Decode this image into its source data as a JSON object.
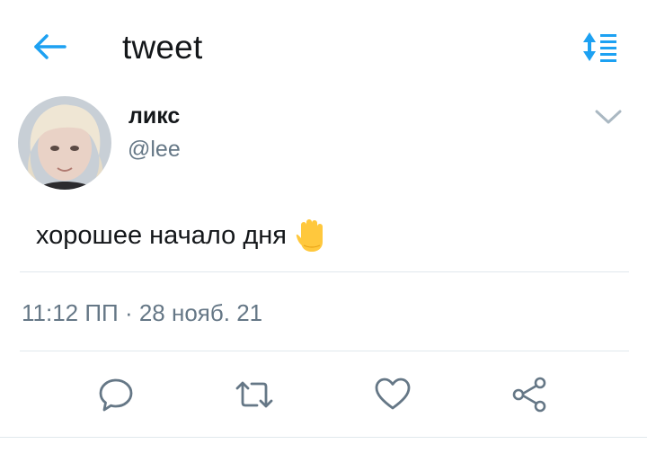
{
  "header": {
    "title": "tweet",
    "back_icon": "arrow-left-icon",
    "sort_icon": "sort-list-icon",
    "accent_color": "#1da1f2"
  },
  "author": {
    "display_name": "ликс",
    "handle": "@lee",
    "avatar_icon": "avatar-photo"
  },
  "tweet": {
    "text": "хорошее начало дня",
    "emoji": "raised-hand-emoji"
  },
  "meta": {
    "timestamp": "11:12 ПП · 28 нояб. 21"
  },
  "actions": [
    "reply-icon",
    "retweet-icon",
    "like-icon",
    "share-icon"
  ],
  "colors": {
    "text": "#14171a",
    "secondary": "#657786",
    "divider": "#e1e8ed",
    "icon": "#657786"
  }
}
